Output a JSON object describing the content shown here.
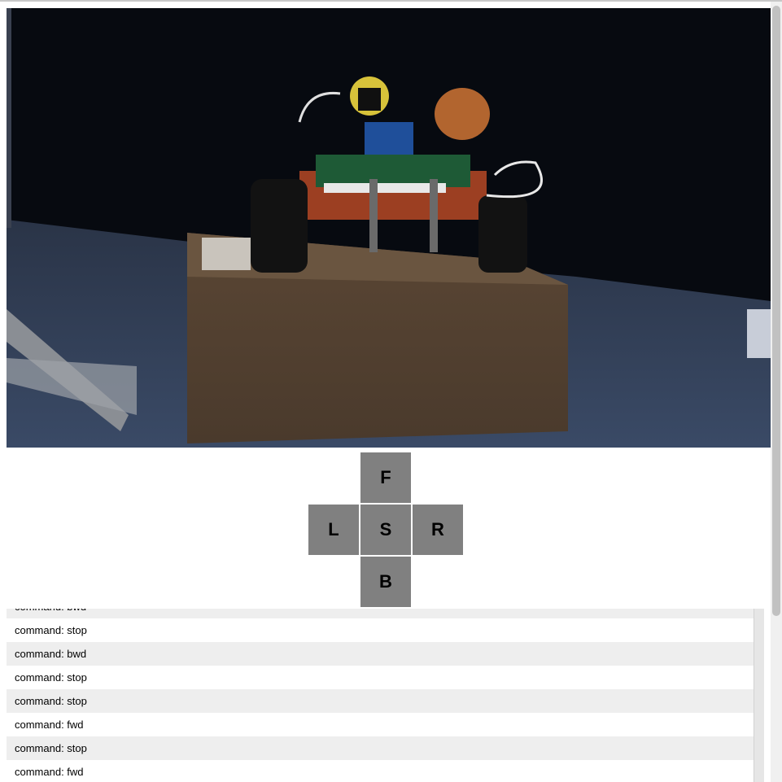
{
  "camera": {
    "description_icon": "camera-feed"
  },
  "controls": {
    "forward": "F",
    "left": "L",
    "stop": "S",
    "right": "R",
    "backward": "B"
  },
  "log": {
    "rows": [
      "command: bwd",
      "command: stop",
      "command: bwd",
      "command: stop",
      "command: stop",
      "command: fwd",
      "command: stop",
      "command: fwd"
    ]
  },
  "colors": {
    "button": "#808080",
    "row_alt": "#eeeeee"
  }
}
